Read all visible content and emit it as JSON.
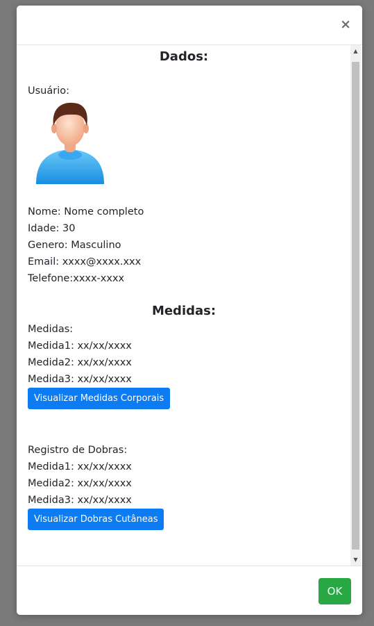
{
  "modal": {
    "close_label": "×",
    "ok_label": "OK"
  },
  "dados": {
    "title": "Dados:",
    "usuario_label": "Usuário:",
    "avatar_icon": "user-avatar-icon",
    "nome": "Nome: Nome completo",
    "idade": "Idade: 30",
    "genero": "Genero: Masculino",
    "email": "Email: xxxx@xxxx.xxx",
    "telefone": "Telefone:xxxx-xxxx"
  },
  "medidas": {
    "title": "Medidas:",
    "label": "Medidas:",
    "items": [
      "Medida1: xx/xx/xxxx",
      "Medida2: xx/xx/xxxx",
      "Medida3: xx/xx/xxxx"
    ],
    "button_label": "Visualizar Medidas Corporais"
  },
  "dobras": {
    "label": "Registro de Dobras:",
    "items": [
      "Medida1: xx/xx/xxxx",
      "Medida2: xx/xx/xxxx",
      "Medida3: xx/xx/xxxx"
    ],
    "button_label": "Visualizar Dobras Cutâneas"
  },
  "colors": {
    "primary_button": "#0d7cf2",
    "success_button": "#28a745",
    "backdrop": "#7a7a7a"
  }
}
